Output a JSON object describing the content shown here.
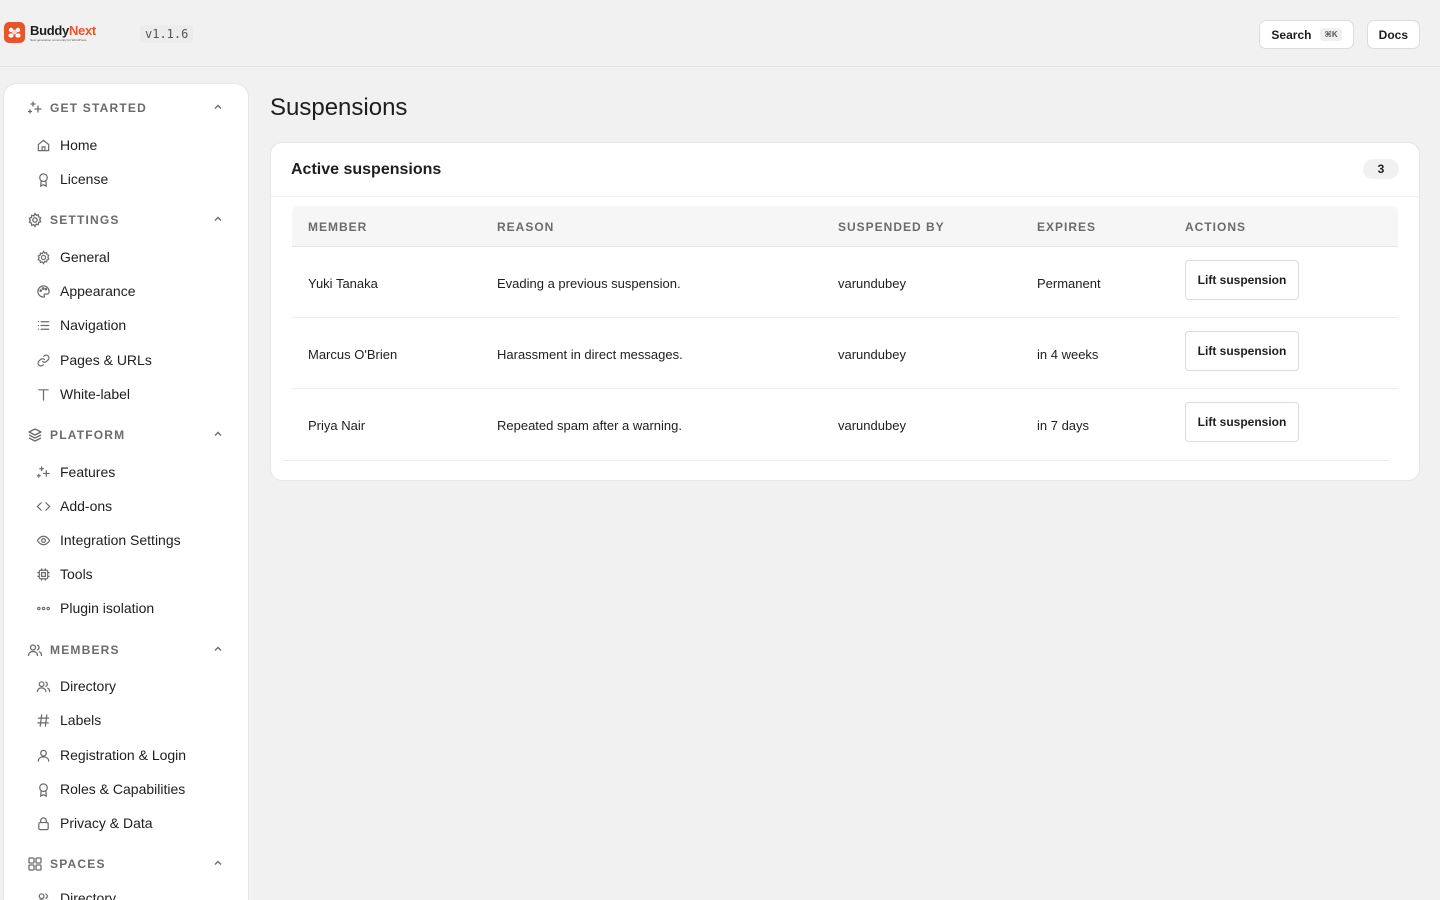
{
  "app": {
    "brand_name_part1": "Buddy",
    "brand_name_part2": "Next",
    "brand_tagline": "Next generation community for WordPress",
    "version": "v1.1.6"
  },
  "topbar": {
    "search_label": "Search",
    "search_shortcut": "⌘K",
    "docs_label": "Docs"
  },
  "sidebar": {
    "sections": [
      {
        "title": "GET STARTED",
        "icon": "sparkles-icon",
        "items": [
          {
            "label": "Home",
            "icon": "home-icon"
          },
          {
            "label": "License",
            "icon": "award-icon"
          }
        ]
      },
      {
        "title": "SETTINGS",
        "icon": "gear-icon",
        "items": [
          {
            "label": "General",
            "icon": "gear-icon"
          },
          {
            "label": "Appearance",
            "icon": "palette-icon"
          },
          {
            "label": "Navigation",
            "icon": "list-icon"
          },
          {
            "label": "Pages & URLs",
            "icon": "link-icon"
          },
          {
            "label": "White-label",
            "icon": "type-icon"
          }
        ]
      },
      {
        "title": "PLATFORM",
        "icon": "layers-icon",
        "items": [
          {
            "label": "Features",
            "icon": "sparkles-icon"
          },
          {
            "label": "Add-ons",
            "icon": "code-icon"
          },
          {
            "label": "Integration Settings",
            "icon": "eye-icon"
          },
          {
            "label": "Tools",
            "icon": "cpu-icon"
          },
          {
            "label": "Plugin isolation",
            "icon": "dots-icon"
          }
        ]
      },
      {
        "title": "MEMBERS",
        "icon": "users-icon",
        "items": [
          {
            "label": "Directory",
            "icon": "users-icon"
          },
          {
            "label": "Labels",
            "icon": "hash-icon"
          },
          {
            "label": "Registration & Login",
            "icon": "user-icon"
          },
          {
            "label": "Roles & Capabilities",
            "icon": "award-icon"
          },
          {
            "label": "Privacy & Data",
            "icon": "lock-icon"
          }
        ]
      },
      {
        "title": "SPACES",
        "icon": "grid-icon",
        "items": [
          {
            "label": "Directory",
            "icon": "users-icon"
          }
        ]
      }
    ]
  },
  "main": {
    "page_title": "Suspensions",
    "card_title": "Active suspensions",
    "count": "3",
    "columns": [
      "MEMBER",
      "REASON",
      "SUSPENDED BY",
      "EXPIRES",
      "ACTIONS"
    ],
    "rows": [
      {
        "member": "Yuki Tanaka",
        "reason": "Evading a previous suspension.",
        "suspended_by": "varundubey",
        "expires": "Permanent",
        "action": "Lift suspension"
      },
      {
        "member": "Marcus O'Brien",
        "reason": "Harassment in direct messages.",
        "suspended_by": "varundubey",
        "expires": "in 4 weeks",
        "action": "Lift suspension"
      },
      {
        "member": "Priya Nair",
        "reason": "Repeated spam after a warning.",
        "suspended_by": "varundubey",
        "expires": "in 7 days",
        "action": "Lift suspension"
      }
    ]
  },
  "colors": {
    "brand_accent": "#e8552a",
    "background": "#f1f1f1",
    "text": "#1e1e1e",
    "muted": "#6b6b6b"
  }
}
